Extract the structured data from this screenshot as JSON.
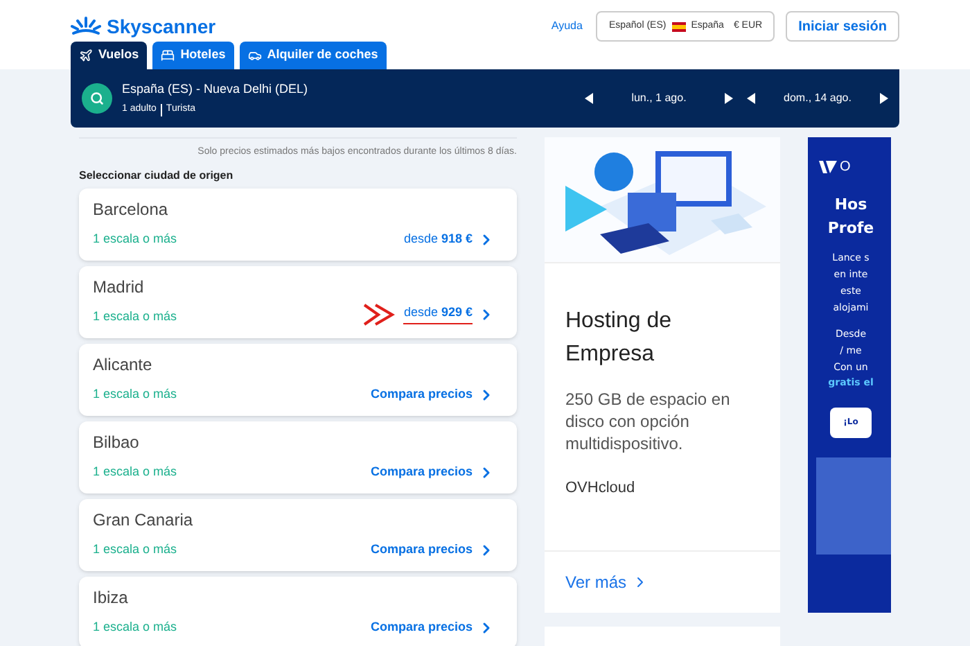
{
  "header": {
    "logo": "Skyscanner",
    "help": "Ayuda",
    "locale": {
      "language": "Español (ES)",
      "country": "España",
      "currency": "€ EUR"
    },
    "login": "Iniciar sesión"
  },
  "tabs": [
    {
      "label": "Vuelos",
      "kind": "plane",
      "selected": true
    },
    {
      "label": "Hoteles",
      "kind": "bed",
      "selected": false
    },
    {
      "label": "Alquiler de coches",
      "kind": "car",
      "selected": false
    }
  ],
  "search_bar": {
    "route": "España (ES) - Nueva Delhi (DEL)",
    "passengers": "1 adulto",
    "cabin": "Turista",
    "depart": "lun., 1 ago.",
    "return": "dom., 14 ago."
  },
  "note": "Solo precios estimados más bajos encontrados durante los últimos 8 días.",
  "list_title": "Seleccionar ciudad de origen",
  "results": [
    {
      "city": "Barcelona",
      "stops": "1 escala o más",
      "kind": "price",
      "action": "desde **918 €**",
      "annotated": false
    },
    {
      "city": "Madrid",
      "stops": "1 escala o más",
      "kind": "price",
      "action": "desde **929 €**",
      "annotated": true
    },
    {
      "city": "Alicante",
      "stops": "1 escala o más",
      "kind": "compare",
      "action": "Compara precios",
      "annotated": false
    },
    {
      "city": "Bilbao",
      "stops": "1 escala o más",
      "kind": "compare",
      "action": "Compara precios",
      "annotated": false
    },
    {
      "city": "Gran Canaria",
      "stops": "1 escala o más",
      "kind": "compare",
      "action": "Compara precios",
      "annotated": false
    },
    {
      "city": "Ibiza",
      "stops": "1 escala o más",
      "kind": "compare",
      "action": "Compara precios",
      "annotated": false
    }
  ],
  "ad": {
    "title": "Hosting de Empresa",
    "body": "250 GB de espacio en disco con opción multidispositivo.",
    "brand": "OVHcloud",
    "link": "Ver más"
  },
  "side_ad": {
    "logo_text": "O",
    "title_lines": [
      "Hos",
      "Profe"
    ],
    "body_lines": [
      "Lance s",
      "en inte",
      "este",
      "alojami"
    ],
    "price_lines": [
      "Desde",
      "/ me",
      "Con un"
    ],
    "highlight": "gratis el",
    "button": "¡Lo"
  }
}
